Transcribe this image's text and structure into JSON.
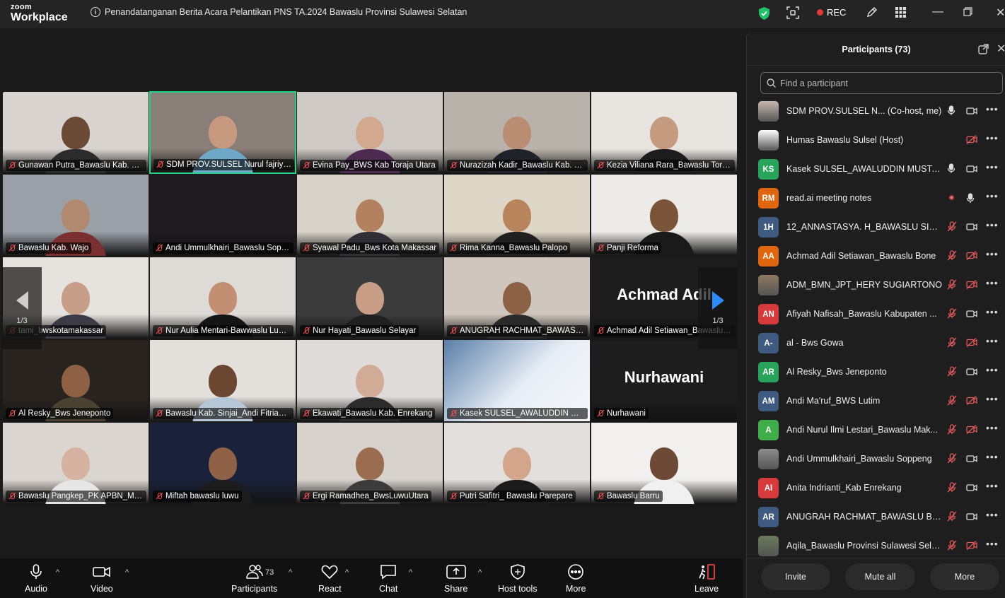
{
  "app": {
    "brand_small": "zoom",
    "brand_large": "Workplace",
    "meeting_title": "Penandatanganan Berita Acara Pelantikan PNS TA.2024 Bawaslu Provinsi Sulawesi Selatan",
    "rec_label": "REC"
  },
  "grid": {
    "page_indicator_left": "1/3",
    "page_indicator_right": "1/3",
    "tiles": [
      {
        "label": "Gunawan Putra_Bawaslu Kab. Sid...",
        "bg": "#d9d4d0",
        "skin": "#6b4a36",
        "shirt": "#2b2b2b"
      },
      {
        "label": "SDM PROV.SULSEL Nurul fajriyah Sa...",
        "bg": "#8a7f78",
        "skin": "#c79a80",
        "shirt": "#6fa7c7",
        "active": true
      },
      {
        "label": "Evina Pay_BWS Kab Toraja Utara",
        "bg": "#cfcac6",
        "skin": "#d2a88f",
        "shirt": "#4d2a4f"
      },
      {
        "label": "Nurazizah Kadir_Bawaslu Kab. Si...",
        "bg": "#b8b2aa",
        "skin": "#b88d72",
        "shirt": "#1f2228"
      },
      {
        "label": "Kezia Viliana Rara_Bawaslu Toraj...",
        "bg": "#e8e4e0",
        "skin": "#c59b80",
        "shirt": "#1c1c1c"
      },
      {
        "label": "Bawaslu Kab. Wajo",
        "bg": "#9aa0a8",
        "skin": "#b0896f",
        "shirt": "#7a3030"
      },
      {
        "label": "Andi Ummulkhairi_Bawaslu Sopp...",
        "bg": "#1e1a1f",
        "blank": true
      },
      {
        "label": "Syawal Padu_Bws Kota Makassar",
        "bg": "#d8d3c8",
        "skin": "#b3815f",
        "shirt": "#2f2f35"
      },
      {
        "label": "Rima Kanna_Bawaslu Palopo",
        "bg": "#ded6c6",
        "skin": "#b8845c",
        "shirt": "#202020"
      },
      {
        "label": "Panji Reforma",
        "bg": "#ecebe8",
        "skin": "#7a5438",
        "shirt": "#1a1a1a"
      },
      {
        "label": "tami_bwskotamakassar",
        "bg": "#e6e2de",
        "skin": "#c79f88",
        "shirt": "#3c3a44"
      },
      {
        "label": "Nur Aulia Mentari-Bawwaslu Luw...",
        "bg": "#dedad6",
        "skin": "#c28f73",
        "shirt": "#151515"
      },
      {
        "label": "Nur Hayati_Bawaslu Selayar",
        "bg": "#3b3b3b",
        "skin": "#c89e86",
        "shirt": "#202020"
      },
      {
        "label": "ANUGRAH RACHMAT_BAWASLU ...",
        "bg": "#cfc7bd",
        "skin": "#8b6245",
        "shirt": "#2a2a2a"
      },
      {
        "label": "Achmad Adil Setiawan_Bawaslu ...",
        "bg": "#1d1d1d",
        "big": "Achmad Adil"
      },
      {
        "label": "Al Resky_Bws Jeneponto",
        "bg": "#2a2420",
        "skin": "#8e6145",
        "shirt": "#4a4230"
      },
      {
        "label": "Bawaslu Kab. Sinjai_Andi Fitrians...",
        "bg": "#e3e0dc",
        "skin": "#6b4630",
        "shirt": "#b5c6d6"
      },
      {
        "label": "Ekawati_Bawaslu Kab. Enrekang",
        "bg": "#dedbd8",
        "skin": "#d2ab96",
        "shirt": "#2b2b2b"
      },
      {
        "label": "Kasek SULSEL_AWALUDDIN MUSTAFA",
        "bg": "#5a7ea8",
        "slide": true
      },
      {
        "label": "Nurhawani",
        "bg": "#1d1d1d",
        "big": "Nurhawani"
      },
      {
        "label": "Bawaslu Pangkep_PK APBN_Mila ...",
        "bg": "#dcd6d0",
        "skin": "#d6b2a0",
        "shirt": "#e6e6e6"
      },
      {
        "label": "Miftah bawaslu luwu",
        "bg": "#19223a",
        "skin": "#8f6247",
        "shirt": "#1c1c1c"
      },
      {
        "label": "Ergi Ramadhea_BwsLuwuUtara",
        "bg": "#d7d2cc",
        "skin": "#9b6d50",
        "shirt": "#3b3b3b"
      },
      {
        "label": "Putri Safitri_ Bawaslu Parepare",
        "bg": "#e3dfdc",
        "skin": "#d3a58a",
        "shirt": "#1b1b1b"
      },
      {
        "label": "Bawaslu Barru",
        "bg": "#f2f0ee",
        "skin": "#6d4a35",
        "shirt": "#f0f0f0"
      }
    ]
  },
  "toolbar": {
    "audio": "Audio",
    "video": "Video",
    "participants": "Participants",
    "participants_count": "73",
    "react": "React",
    "chat": "Chat",
    "share": "Share",
    "host_tools": "Host tools",
    "more": "More",
    "leave": "Leave"
  },
  "panel": {
    "title": "Participants (73)",
    "search_placeholder": "Find a participant",
    "invite": "Invite",
    "mute_all": "Mute all",
    "more": "More",
    "participants": [
      {
        "name": "SDM PROV.SULSEL N...  (Co-host, me)",
        "initials": "",
        "color": "#c9b8ae",
        "mic": "on",
        "cam": "on"
      },
      {
        "name": "Humas Bawaslu Sulsel (Host)",
        "initials": "",
        "color": "#ffffff",
        "mic": "none",
        "cam": "off"
      },
      {
        "name": "Kasek SULSEL_AWALUDDIN MUSTAFA",
        "initials": "KS",
        "color": "#27a35a",
        "mic": "on",
        "cam": "on"
      },
      {
        "name": "read.ai meeting notes",
        "initials": "RM",
        "color": "#e0650f",
        "mic": "rec",
        "cam": "mic"
      },
      {
        "name": "12_ANNASTASYA. H_BAWASLU SIDR...",
        "initials": "1H",
        "color": "#3e5a80",
        "mic": "off",
        "cam": "on"
      },
      {
        "name": "Achmad Adil Setiawan_Bawaslu Bone",
        "initials": "AA",
        "color": "#e0650f",
        "mic": "off",
        "cam": "off"
      },
      {
        "name": "ADM_BMN_JPT_HERY SUGIARTONO",
        "initials": "",
        "color": "#8f7a5f",
        "mic": "off",
        "cam": "off"
      },
      {
        "name": "Afiyah Nafisah_Bawaslu Kabupaten ...",
        "initials": "AN",
        "color": "#d63a3a",
        "mic": "off",
        "cam": "on"
      },
      {
        "name": "al - Bws Gowa",
        "initials": "A-",
        "color": "#3e5a80",
        "mic": "off",
        "cam": "off"
      },
      {
        "name": "Al Resky_Bws Jeneponto",
        "initials": "AR",
        "color": "#27a35a",
        "mic": "off",
        "cam": "on"
      },
      {
        "name": "Andi Ma'ruf_BWS Lutim",
        "initials": "AM",
        "color": "#3e5a80",
        "mic": "off",
        "cam": "off"
      },
      {
        "name": "Andi Nurul Ilmi Lestari_Bawaslu Mak...",
        "initials": "A",
        "color": "#3fae4a",
        "mic": "off",
        "cam": "off"
      },
      {
        "name": "Andi Ummulkhairi_Bawaslu Soppeng",
        "initials": "",
        "color": "#8c8c8c",
        "mic": "off",
        "cam": "on"
      },
      {
        "name": "Anita Indrianti_Kab Enrekang",
        "initials": "AI",
        "color": "#d63a3a",
        "mic": "off",
        "cam": "on"
      },
      {
        "name": "ANUGRAH RACHMAT_BAWASLU BU...",
        "initials": "AR",
        "color": "#3e5a80",
        "mic": "off",
        "cam": "on"
      },
      {
        "name": "Aqila_Bawaslu Provinsi Sulawesi Sela...",
        "initials": "",
        "color": "#6a7a5a",
        "mic": "off",
        "cam": "off"
      }
    ]
  }
}
